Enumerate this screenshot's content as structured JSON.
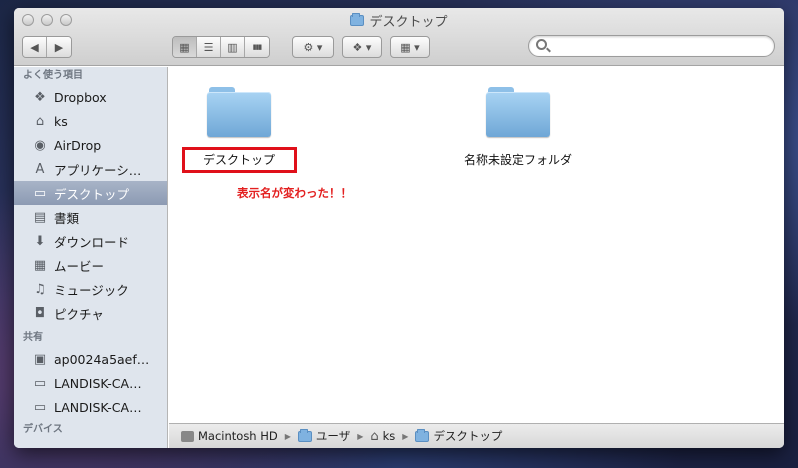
{
  "window": {
    "title": "デスクトップ"
  },
  "toolbar": {
    "back_label": "◀",
    "forward_label": "▶",
    "view_icon": "▦",
    "view_list": "☰",
    "view_columns": "▥",
    "view_coverflow": "▮▮▮",
    "action_label": "⚙ ▾",
    "dropbox_label": "❖ ▾",
    "arrange_label": "▦ ▾",
    "search_placeholder": ""
  },
  "sidebar": {
    "favorites_header": "よく使う項目",
    "favorites": [
      {
        "label": "Dropbox",
        "icon": "❖"
      },
      {
        "label": "ks",
        "icon": "⌂"
      },
      {
        "label": "AirDrop",
        "icon": "◉"
      },
      {
        "label": "アプリケーシ…",
        "icon": "A"
      },
      {
        "label": "デスクトップ",
        "icon": "▭"
      },
      {
        "label": "書類",
        "icon": "▤"
      },
      {
        "label": "ダウンロード",
        "icon": "⬇"
      },
      {
        "label": "ムービー",
        "icon": "▦"
      },
      {
        "label": "ミュージック",
        "icon": "♫"
      },
      {
        "label": "ピクチャ",
        "icon": "◘"
      }
    ],
    "shared_header": "共有",
    "shared": [
      {
        "label": "ap0024a5aef…",
        "icon": "▣"
      },
      {
        "label": "LANDISK-CA…",
        "icon": "▭"
      },
      {
        "label": "LANDISK-CA…",
        "icon": "▭"
      }
    ],
    "devices_header": "デバイス"
  },
  "content": {
    "items": [
      {
        "label": "デスクトップ"
      },
      {
        "label": "名称未設定フォルダ"
      }
    ],
    "annotation": "表示名が変わった！！"
  },
  "pathbar": {
    "segments": [
      "Macintosh HD",
      "ユーザ",
      "ks",
      "デスクトップ"
    ],
    "separator": "▶"
  }
}
